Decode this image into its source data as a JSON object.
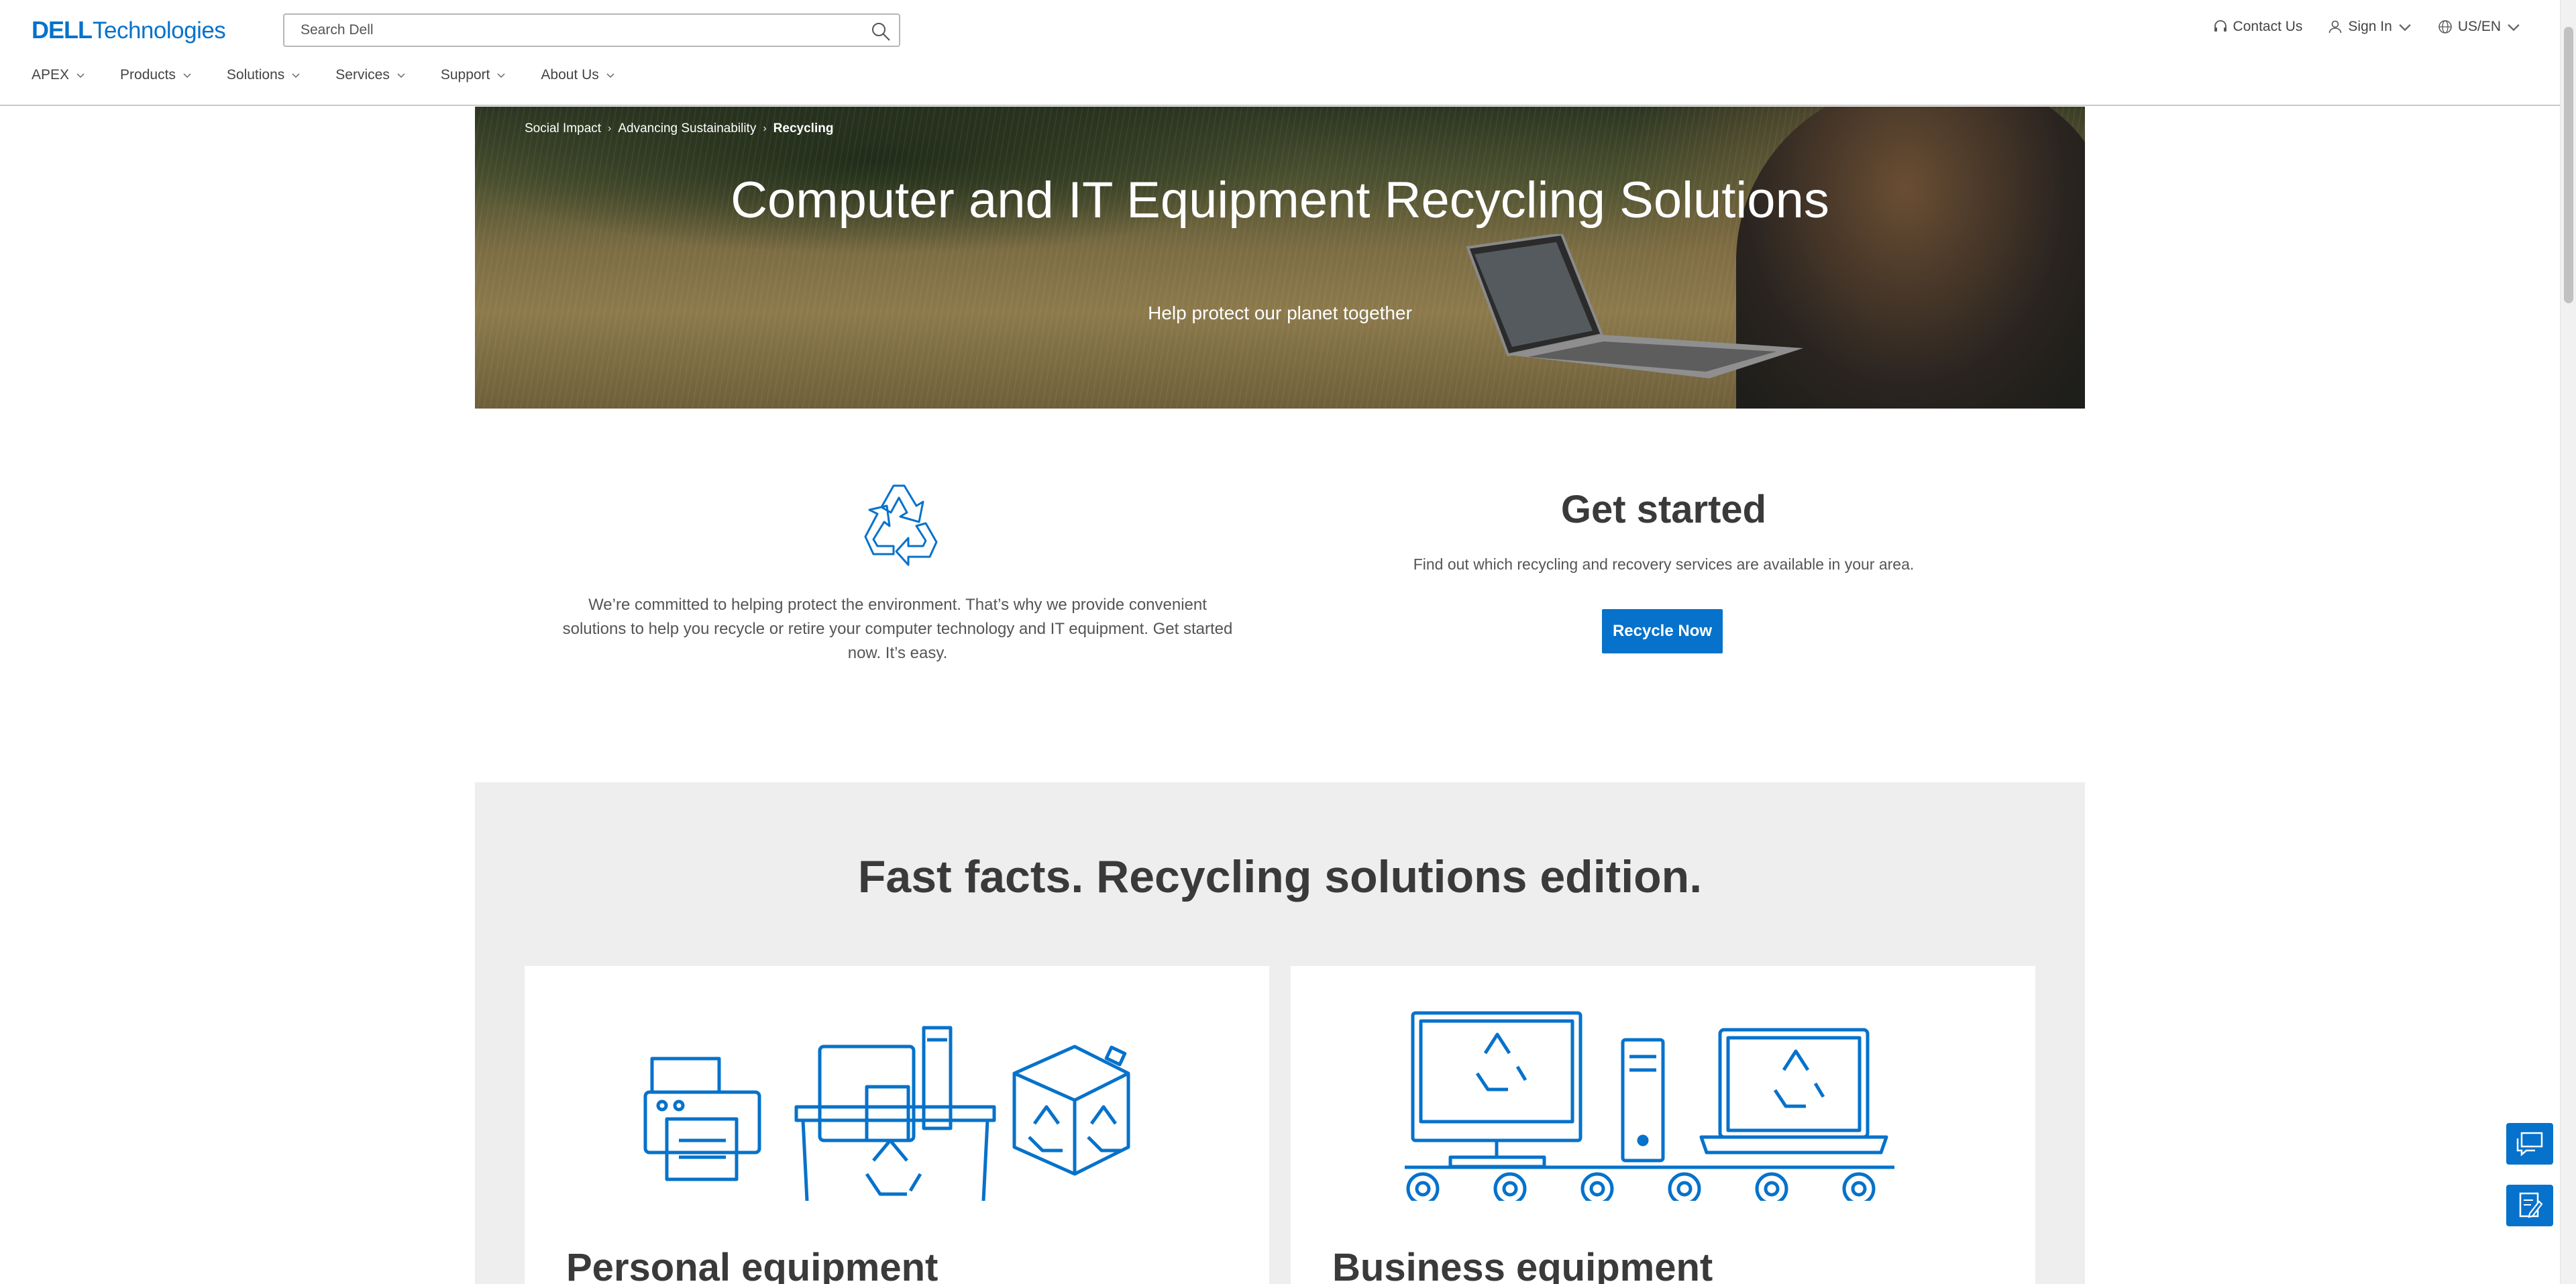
{
  "brand": {
    "logo_bold": "DELL",
    "logo_light": "Technologies",
    "color": "#0672cb"
  },
  "search": {
    "placeholder": "Search Dell"
  },
  "utilities": {
    "contact": "Contact Us",
    "sign_in": "Sign In",
    "locale": "US/EN"
  },
  "nav": {
    "items": [
      {
        "label": "APEX"
      },
      {
        "label": "Products"
      },
      {
        "label": "Solutions"
      },
      {
        "label": "Services"
      },
      {
        "label": "Support"
      },
      {
        "label": "About Us"
      }
    ]
  },
  "breadcrumb": {
    "items": [
      "Social Impact",
      "Advancing Sustainability"
    ],
    "current": "Recycling"
  },
  "hero": {
    "title": "Computer and IT Equipment Recycling Solutions",
    "subtitle": "Help protect our planet together"
  },
  "intro": {
    "text": "We’re committed to helping protect the environment. That’s why we provide convenient solutions to help you recycle or retire your computer technology and IT equipment. Get started now. It’s easy."
  },
  "get_started": {
    "title": "Get started",
    "text": "Find out which recycling and recovery services are available in your area.",
    "button": "Recycle Now"
  },
  "facts": {
    "title": "Fast facts. Recycling solutions edition.",
    "cards": [
      {
        "title": "Personal equipment",
        "icon": "personal-equipment-recycling-icon"
      },
      {
        "title": "Business equipment",
        "icon": "business-equipment-recycling-icon"
      }
    ]
  },
  "floating": {
    "chat_icon": "chat-icon",
    "survey_icon": "feedback-icon"
  }
}
